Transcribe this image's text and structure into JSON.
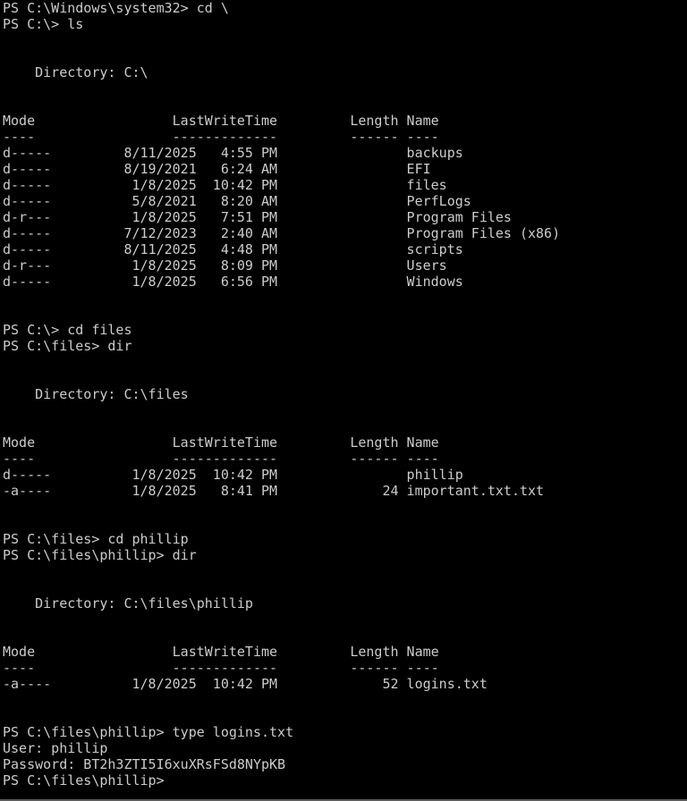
{
  "theme": {
    "background": "#000000",
    "foreground": "#cccccc"
  },
  "terminal": {
    "lines": [
      "PS C:\\Windows\\system32> cd \\",
      "PS C:\\> ls",
      "",
      "",
      "    Directory: C:\\",
      "",
      "",
      "Mode                 LastWriteTime         Length Name",
      "----                 -------------         ------ ----",
      "d-----         8/11/2025   4:55 PM                backups",
      "d-----         8/19/2021   6:24 AM                EFI",
      "d-----          1/8/2025  10:42 PM                files",
      "d-----          5/8/2021   8:20 AM                PerfLogs",
      "d-r---          1/8/2025   7:51 PM                Program Files",
      "d-----         7/12/2023   2:40 AM                Program Files (x86)",
      "d-----         8/11/2025   4:48 PM                scripts",
      "d-r---          1/8/2025   8:09 PM                Users",
      "d-----          1/8/2025   6:56 PM                Windows",
      "",
      "",
      "PS C:\\> cd files",
      "PS C:\\files> dir",
      "",
      "",
      "    Directory: C:\\files",
      "",
      "",
      "Mode                 LastWriteTime         Length Name",
      "----                 -------------         ------ ----",
      "d-----          1/8/2025  10:42 PM                phillip",
      "-a----          1/8/2025   8:41 PM             24 important.txt.txt",
      "",
      "",
      "PS C:\\files> cd phillip",
      "PS C:\\files\\phillip> dir",
      "",
      "",
      "    Directory: C:\\files\\phillip",
      "",
      "",
      "Mode                 LastWriteTime         Length Name",
      "----                 -------------         ------ ----",
      "-a----          1/8/2025  10:42 PM             52 logins.txt",
      "",
      "",
      "PS C:\\files\\phillip> type logins.txt",
      "User: phillip",
      "Password: BT2h3ZTI5I6xuXRsFSd8NYpKB",
      "PS C:\\files\\phillip>"
    ]
  }
}
